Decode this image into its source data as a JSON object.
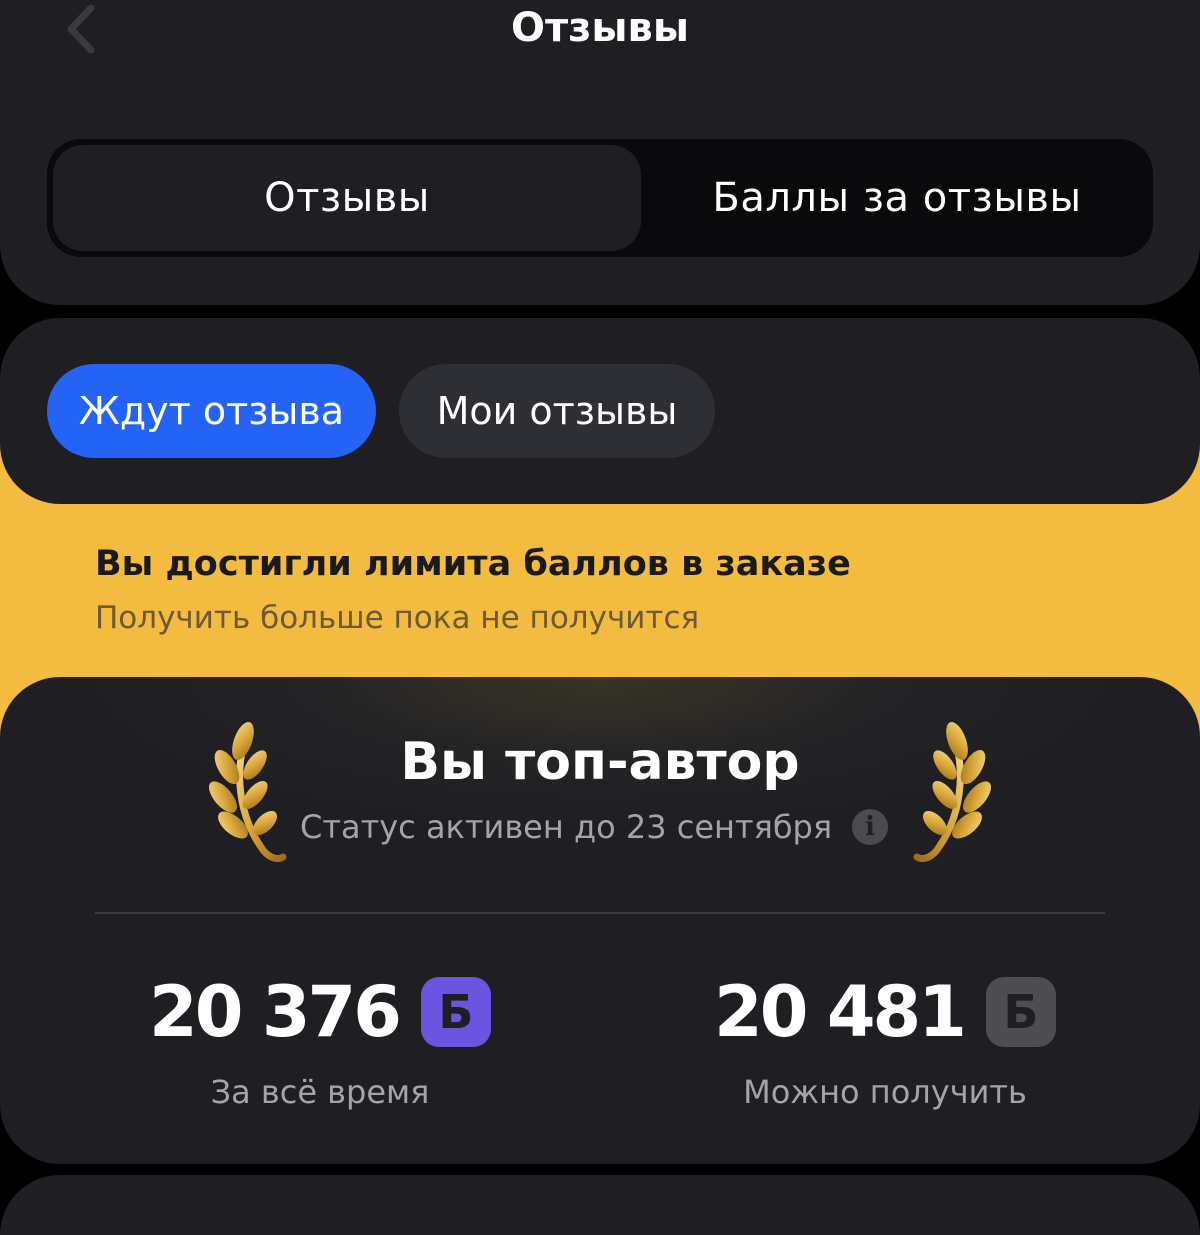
{
  "header": {
    "title": "Отзывы",
    "back_icon": "chevron-left-icon"
  },
  "segmented": {
    "tabs": [
      {
        "label": "Отзывы",
        "active": true
      },
      {
        "label": "Баллы за отзывы",
        "active": false
      }
    ]
  },
  "filters": {
    "chips": [
      {
        "label": "Ждут отзыва",
        "active": true
      },
      {
        "label": "Мои отзывы",
        "active": false
      }
    ]
  },
  "limit_banner": {
    "title": "Вы достигли лимита баллов в заказе",
    "subtitle": "Получить больше пока не получится"
  },
  "author": {
    "title": "Вы топ-автор",
    "status": "Статус активен до 23 сентября",
    "info_icon": "info-icon",
    "laurel_icon": "laurel-icon",
    "stats": [
      {
        "value": "20 376",
        "currency": "Б",
        "label": "За всё время"
      },
      {
        "value": "20 481",
        "currency": "Б",
        "label": "Можно получить"
      }
    ]
  },
  "colors": {
    "background": "#000000",
    "card": "#1f1f23",
    "accent_blue": "#2563f5",
    "banner_yellow": "#f4bb41",
    "badge_purple": "#6a54e0",
    "badge_grey": "#4d4d52",
    "gold": "#d9a73a"
  }
}
